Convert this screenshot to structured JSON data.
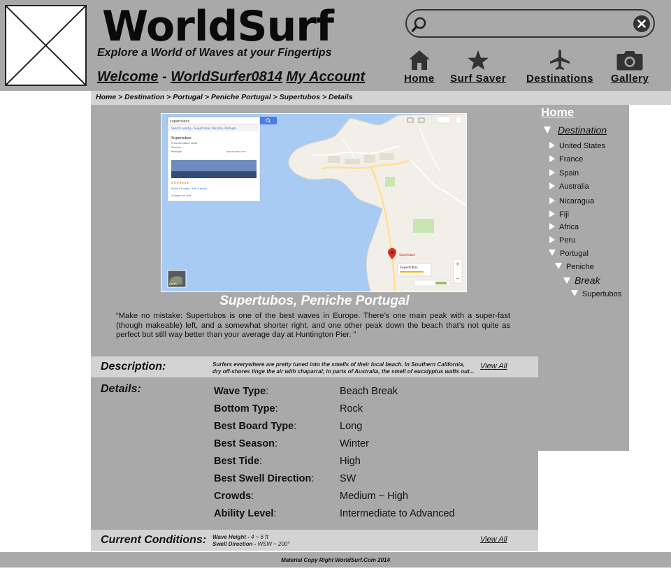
{
  "header": {
    "site_title": "WorldSurf",
    "tagline": "Explore a World of Waves at your Fingertips",
    "welcome_prefix": "Welcome",
    "separator": "-",
    "username": "WorldSurfer0814",
    "account_link": "My Account",
    "search": {
      "value": "",
      "placeholder": ""
    },
    "nav": [
      {
        "label": "Home",
        "icon": "home-icon"
      },
      {
        "label": "Surf Saver",
        "icon": "star-icon"
      },
      {
        "label": "Destinations",
        "icon": "airplane-icon"
      },
      {
        "label": "Gallery",
        "icon": "camera-icon"
      }
    ]
  },
  "breadcrumb": {
    "items": [
      "Home",
      "Destination",
      "Portugal",
      "Peniche Portugal",
      "Supertubos",
      "Details"
    ],
    "separator": ">"
  },
  "main": {
    "map_icon": "map-screenshot",
    "spot_title": "Supertubos, Peniche Portugal",
    "quote": "“Make no mistake: Supertubos is one of the best waves in Europe. There’s one main peak with a super-fast (though makeable) left, and a somewhat shorter right, and one other peak down the beach that’s not quite as perfect but still way better than your average day at Huntington Pier. ”",
    "description": {
      "label": "Description:",
      "line1": "Surfers everywhere are pretty tuned into the smells of their local beach. In Southern California,",
      "line2": "dry off-shores tinge the air with chaparral; in parts of Australia, the smell of eucalyptus wafts out...",
      "view_all": "View All"
    },
    "details": {
      "label": "Details:",
      "rows": [
        {
          "key": "Wave Type",
          "value": "Beach Break"
        },
        {
          "key": "Bottom Type",
          "value": "Rock"
        },
        {
          "key": "Best Board Type",
          "value": "Long"
        },
        {
          "key": "Best Season",
          "value": "Winter"
        },
        {
          "key": "Best Tide",
          "value": "High"
        },
        {
          "key": "Best Swell Direction",
          "value": "SW"
        },
        {
          "key": "Crowds",
          "value": "Medium ~ High"
        },
        {
          "key": "Ability Level",
          "value": "Intermediate to Advanced"
        }
      ]
    },
    "conditions": {
      "label": "Current Conditions:",
      "wave_height_label": "Wave Height -",
      "wave_height_value": "4 ~ 6 ft",
      "swell_dir_label": "Swell Direction -",
      "swell_dir_value": "WSW ~ 200°",
      "view_all": "View All"
    }
  },
  "map": {
    "search_text": "supertubos",
    "listing_title": "Supertubos",
    "side_link": "supertubos.com",
    "place_label": "Supertubos",
    "earth_label": "Earth",
    "rating": "4.8",
    "search_button": "search-icon"
  },
  "sidebar": {
    "home": "Home",
    "destination": "Destination",
    "countries": [
      "United States",
      "France",
      "Spain",
      "Australia",
      "Nicaragua",
      "Fiji",
      "Africa",
      "Peru"
    ],
    "open_country": "Portugal",
    "open_region": "Peniche",
    "open_category": "Break",
    "open_spot": "Supertubos"
  },
  "footer": {
    "text": "Material Copy Right WorldSurf.Com 2014"
  },
  "colors": {
    "panel": "#a9a9a9",
    "band": "#d3d3d3",
    "water": "#a7cbf3",
    "land": "#f2efe9"
  }
}
